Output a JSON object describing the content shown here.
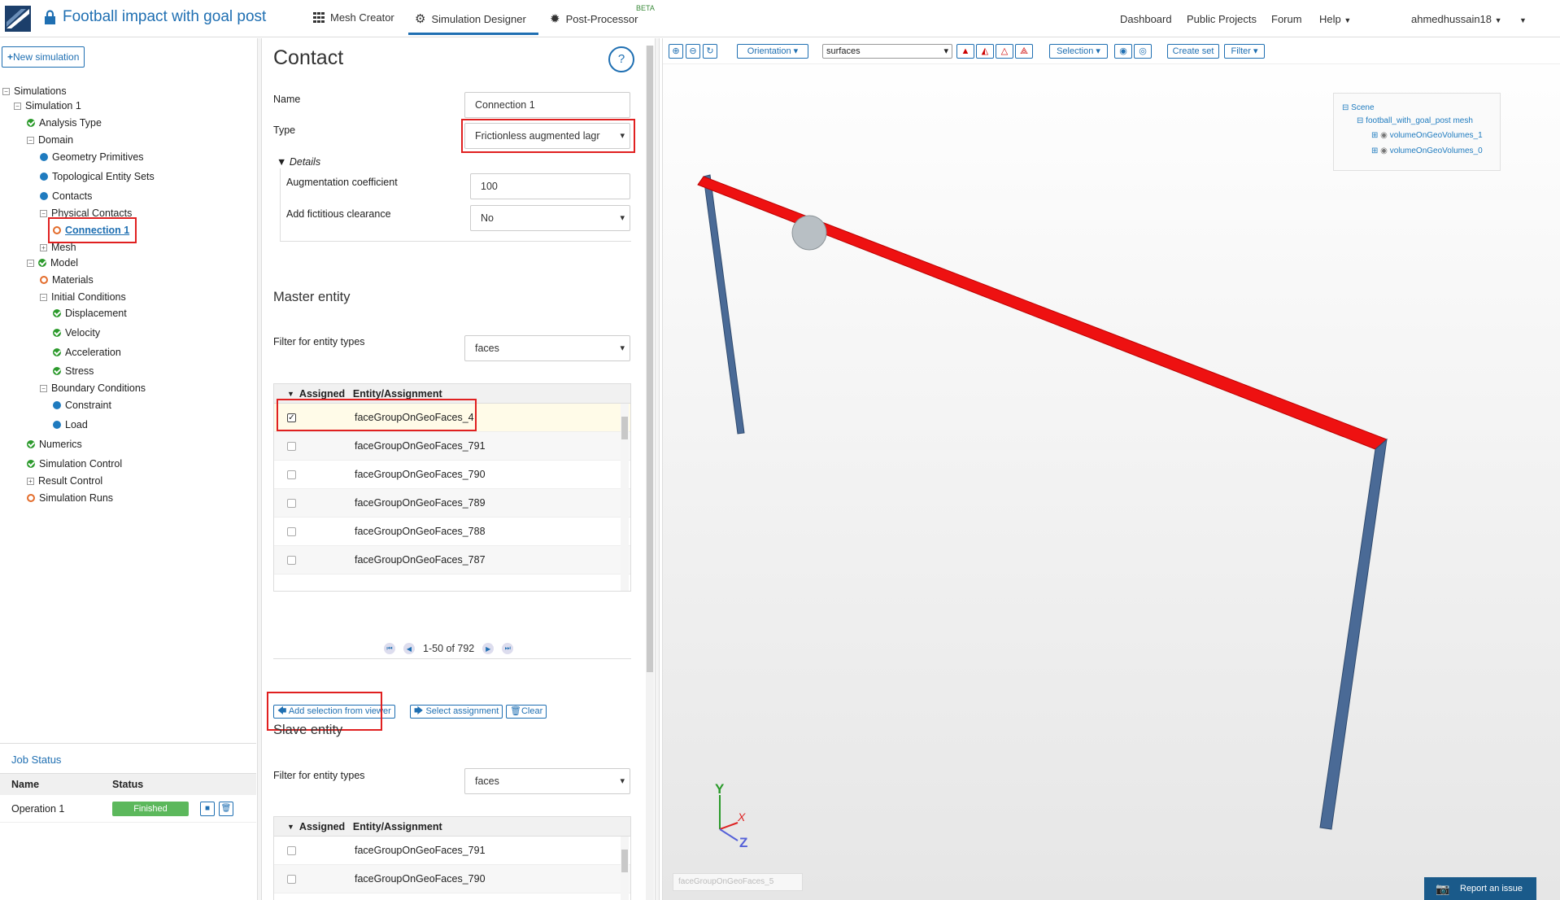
{
  "header": {
    "project_title": "Football impact with goal post",
    "tabs": [
      {
        "label": "Mesh Creator",
        "icon": "grid-icon"
      },
      {
        "label": "Simulation Designer",
        "icon": "gears-icon"
      },
      {
        "label": "Post-Processor",
        "icon": "gear-icon"
      }
    ],
    "beta": "BETA",
    "nav": [
      "Dashboard",
      "Public Projects",
      "Forum",
      "Help"
    ],
    "user": "ahmedhussain18"
  },
  "sidebar": {
    "new_sim": "New simulation",
    "tree": [
      "Simulations",
      "Simulation 1",
      "Analysis Type",
      "Domain",
      "Geometry Primitives",
      "Topological Entity Sets",
      "Contacts",
      "Physical Contacts",
      "Connection 1",
      "Mesh",
      "Model",
      "Materials",
      "Initial Conditions",
      "Displacement",
      "Velocity",
      "Acceleration",
      "Stress",
      "Boundary Conditions",
      "Constraint",
      "Load",
      "Numerics",
      "Simulation Control",
      "Result Control",
      "Simulation Runs"
    ]
  },
  "jobs": {
    "title": "Job Status",
    "col_name": "Name",
    "col_status": "Status",
    "rows": [
      {
        "name": "Operation 1",
        "status": "Finished"
      }
    ]
  },
  "contact": {
    "title": "Contact",
    "help": "?",
    "name_label": "Name",
    "name_value": "Connection 1",
    "type_label": "Type",
    "type_value": "Frictionless augmented lagr",
    "details": "Details",
    "aug_label": "Augmentation coefficient",
    "aug_value": "100",
    "clear_label": "Add fictitious clearance",
    "clear_value": "No"
  },
  "master": {
    "title": "Master entity",
    "filter_label": "Filter for entity types",
    "filter_value": "faces",
    "col_assigned": "Assigned",
    "col_entity": "Entity/Assignment",
    "rows": [
      {
        "name": "faceGroupOnGeoFaces_4",
        "checked": true
      },
      {
        "name": "faceGroupOnGeoFaces_791",
        "checked": false
      },
      {
        "name": "faceGroupOnGeoFaces_790",
        "checked": false
      },
      {
        "name": "faceGroupOnGeoFaces_789",
        "checked": false
      },
      {
        "name": "faceGroupOnGeoFaces_788",
        "checked": false
      },
      {
        "name": "faceGroupOnGeoFaces_787",
        "checked": false
      }
    ],
    "pager": "1-50 of 792"
  },
  "actions": {
    "add": "Add selection from viewer",
    "select": "Select assignment",
    "clear": "Clear"
  },
  "slave": {
    "title": "Slave entity",
    "filter_label": "Filter for entity types",
    "filter_value": "faces",
    "col_assigned": "Assigned",
    "col_entity": "Entity/Assignment",
    "rows": [
      {
        "name": "faceGroupOnGeoFaces_791"
      },
      {
        "name": "faceGroupOnGeoFaces_790"
      }
    ]
  },
  "viewer": {
    "orientation": "Orientation",
    "surfaces": "surfaces",
    "selection": "Selection",
    "create_set": "Create set",
    "filter": "Filter",
    "scene": "Scene",
    "mesh": "football_with_goal_post mesh",
    "vol1": "volumeOnGeoVolumes_1",
    "vol0": "volumeOnGeoVolumes_0",
    "axis_x": "X",
    "axis_y": "Y",
    "axis_z": "Z",
    "hover_tag": "faceGroupOnGeoFaces_5",
    "report": "Report an issue",
    "colors": {
      "crossbar": "#ee1111",
      "posts": "#4a6a96"
    }
  }
}
